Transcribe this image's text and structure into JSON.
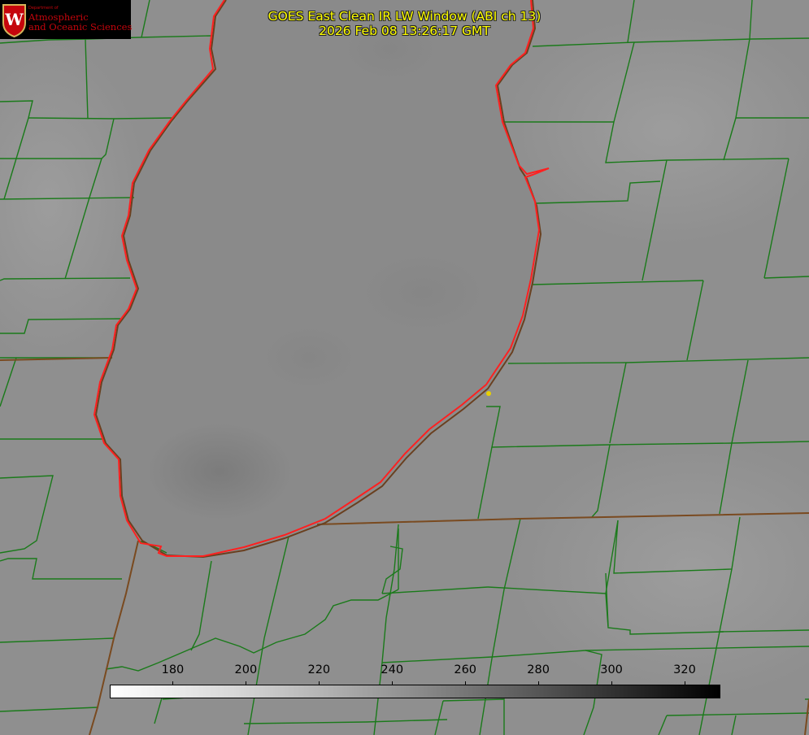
{
  "header": {
    "title_line1": "GOES East Clean IR LW Window (ABI ch 13)",
    "title_line2": "2026 Feb 08 13:26:17 GMT"
  },
  "logo": {
    "department": "Department of",
    "name_line1": "Atmospheric",
    "name_line2": "and Oceanic Sciences",
    "emblem_letter": "W"
  },
  "colorbar": {
    "ticks": [
      "180",
      "200",
      "220",
      "240",
      "260",
      "280",
      "300",
      "320"
    ],
    "tick_values": [
      180,
      200,
      220,
      240,
      260,
      280,
      300,
      320
    ],
    "range": [
      163,
      330
    ],
    "gradient": "white-to-black"
  },
  "colors": {
    "shoreline": "#ff2020",
    "boundaries": "#1a7a1a",
    "title_text": "#ffff00",
    "marker": "#e8d000"
  }
}
